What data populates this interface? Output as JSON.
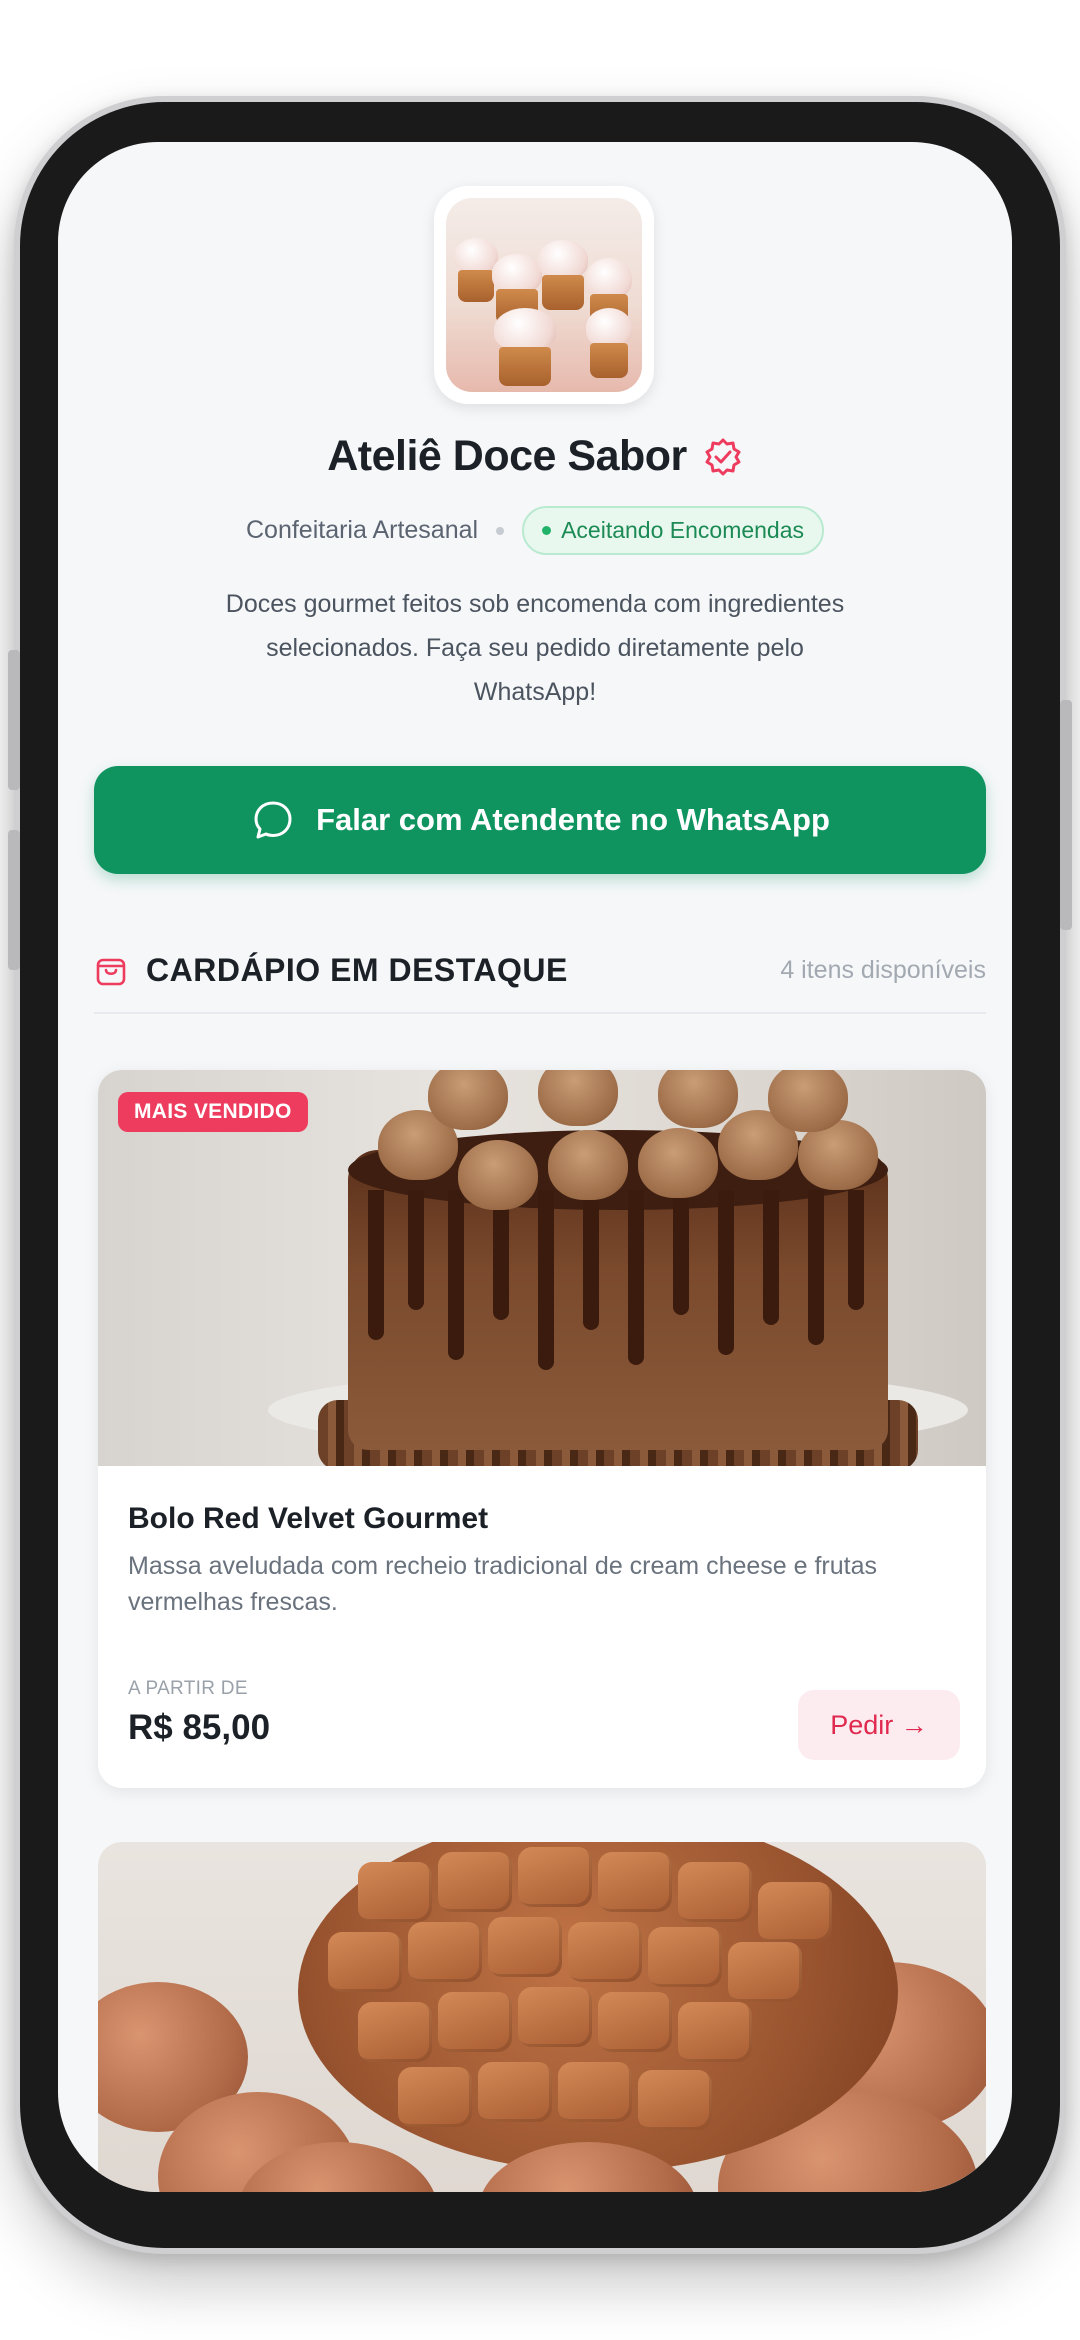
{
  "profile": {
    "name": "Ateliê Doce Sabor",
    "category": "Confeitaria Artesanal",
    "status": "Aceitando Encomendas",
    "description": "Doces gourmet feitos sob encomenda com ingredientes selecionados. Faça seu pedido diretamente pelo WhatsApp!",
    "verified_icon": "verified-check-icon",
    "avatar_icon": "cupcakes-photo"
  },
  "cta": {
    "label": "Falar com Atendente no WhatsApp",
    "icon": "chat-bubble-icon"
  },
  "menu_section": {
    "title": "CARDÁPIO EM DESTAQUE",
    "count_text": "4 itens disponíveis",
    "icon": "shopping-bag-icon"
  },
  "items": [
    {
      "badge": "MAIS VENDIDO",
      "title": "Bolo Red Velvet Gourmet",
      "description": "Massa aveludada com recheio tradicional de cream cheese e frutas vermelhas frescas.",
      "price_label": "A PARTIR DE",
      "price": "R$ 85,00",
      "order_label": "Pedir →",
      "image": "chocolate-drip-cake-photo"
    },
    {
      "image": "chocolate-easter-egg-photo"
    }
  ],
  "colors": {
    "primary_green": "#0f9460",
    "accent_red": "#ee3c5e",
    "status_green": "#1c8a54",
    "text_dark": "#1c2128"
  }
}
